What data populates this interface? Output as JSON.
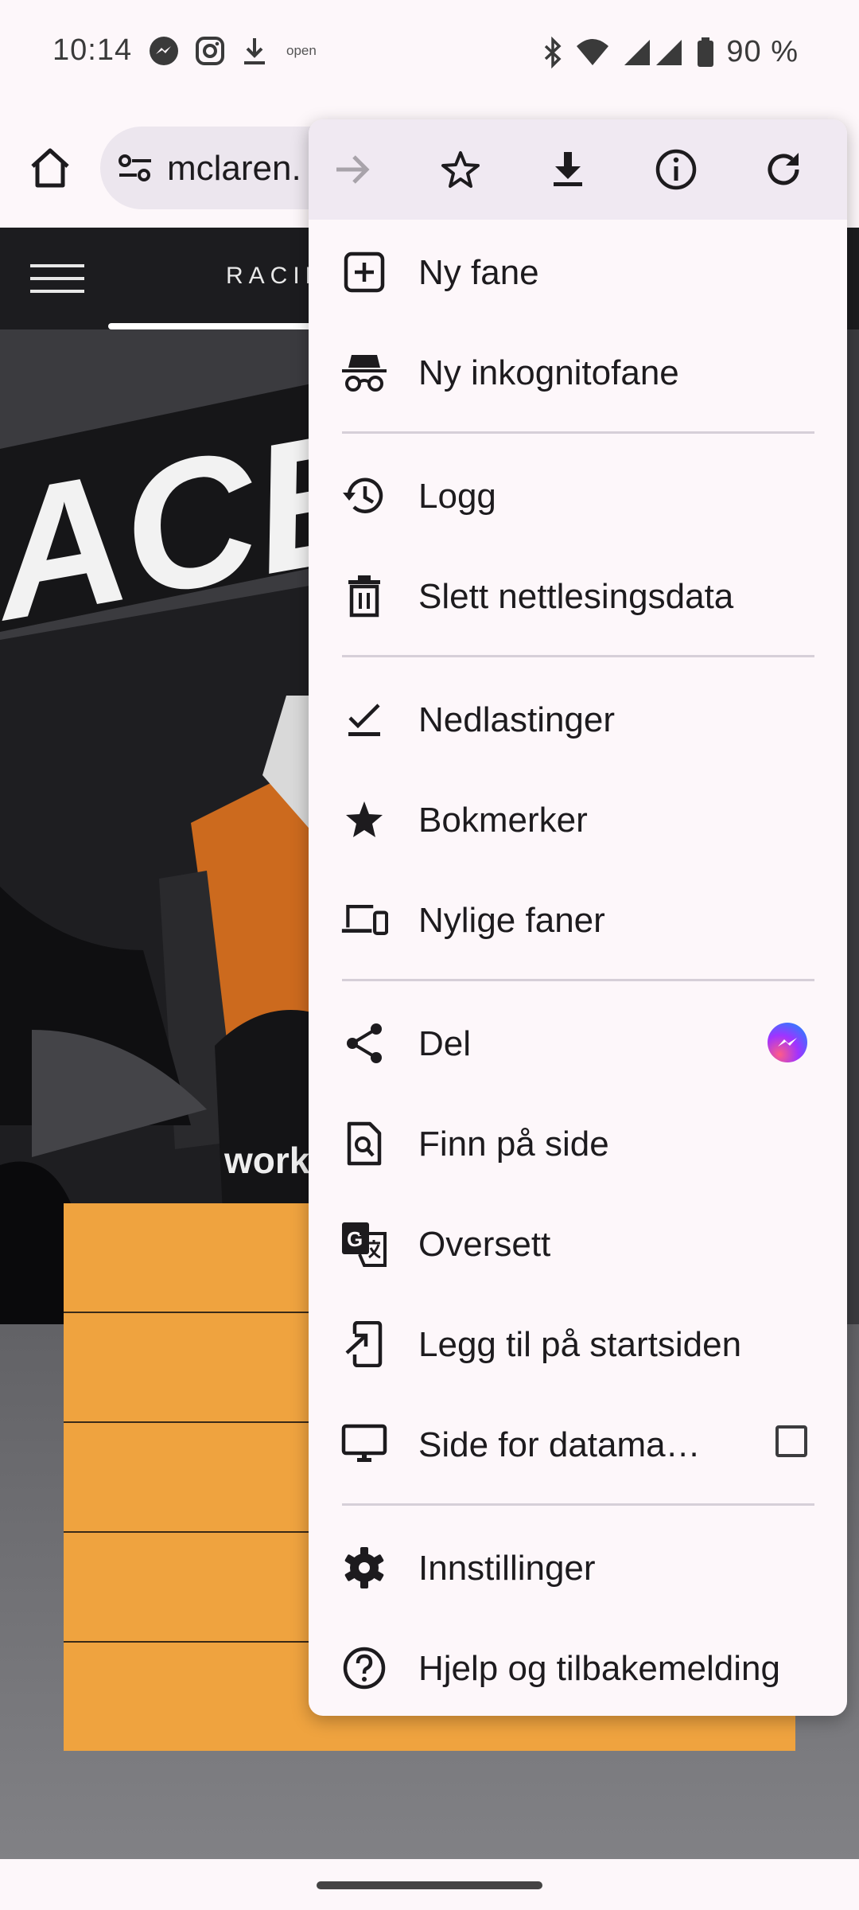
{
  "status_bar": {
    "time": "10:14",
    "notification_icons": [
      "messenger-icon",
      "instagram-icon",
      "download-icon"
    ],
    "open_label": "open",
    "right_icons": [
      "bluetooth-icon",
      "wifi-icon",
      "signal-icon",
      "battery-icon"
    ],
    "battery": "90 %"
  },
  "toolbar": {
    "url": "mclaren.",
    "home_icon": "home-icon",
    "site_settings_icon": "tune-icon"
  },
  "page": {
    "nav_text": "RACIN",
    "hero_text": "ACE",
    "sponsor_text": "workd",
    "accent_color": "#efa33f"
  },
  "menu": {
    "top_actions": [
      "forward-icon",
      "bookmark-star-icon",
      "download-page-icon",
      "page-info-icon",
      "refresh-icon"
    ],
    "items": [
      {
        "label": "Ny fane",
        "icon": "new-tab-icon"
      },
      {
        "label": "Ny inkognitofane",
        "icon": "incognito-icon"
      },
      {
        "label": "Logg",
        "icon": "history-icon"
      },
      {
        "label": "Slett nettlesingsdata",
        "icon": "trash-icon"
      },
      {
        "label": "Nedlastinger",
        "icon": "downloads-icon"
      },
      {
        "label": "Bokmerker",
        "icon": "bookmarks-icon"
      },
      {
        "label": "Nylige faner",
        "icon": "devices-icon"
      },
      {
        "label": "Del",
        "icon": "share-icon"
      },
      {
        "label": "Finn på side",
        "icon": "find-in-page-icon"
      },
      {
        "label": "Oversett",
        "icon": "translate-icon"
      },
      {
        "label": "Legg til på startsiden",
        "icon": "add-to-home-icon"
      },
      {
        "label": "Side for datama…",
        "icon": "desktop-icon",
        "checked": false
      },
      {
        "label": "Innstillinger",
        "icon": "settings-icon"
      },
      {
        "label": "Hjelp og tilbakemelding",
        "icon": "help-icon"
      }
    ]
  }
}
